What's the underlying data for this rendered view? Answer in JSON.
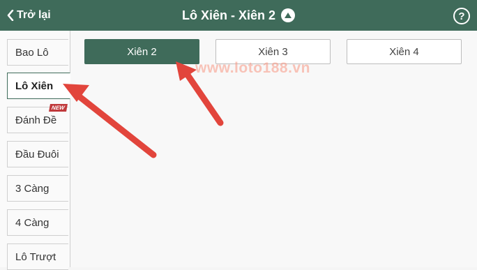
{
  "header": {
    "back_label": "Trở lại",
    "title": "Lô Xiên - Xiên 2",
    "help_label": "?"
  },
  "sidebar": {
    "items": [
      {
        "label": "Bao Lô"
      },
      {
        "label": "Lô Xiên",
        "active": true
      },
      {
        "label": "Đánh Đề",
        "badge": "NEW"
      },
      {
        "label": "Đầu Đuôi"
      },
      {
        "label": "3 Càng"
      },
      {
        "label": "4 Càng"
      },
      {
        "label": "Lô Trượt"
      }
    ]
  },
  "tabs": [
    {
      "label": "Xiên 2",
      "active": true
    },
    {
      "label": "Xiên 3"
    },
    {
      "label": "Xiên 4"
    }
  ],
  "watermark": "www.loto188.vn",
  "colors": {
    "primary": "#3f6b5a",
    "arrow": "#e2453c",
    "badge": "#c0393b"
  }
}
